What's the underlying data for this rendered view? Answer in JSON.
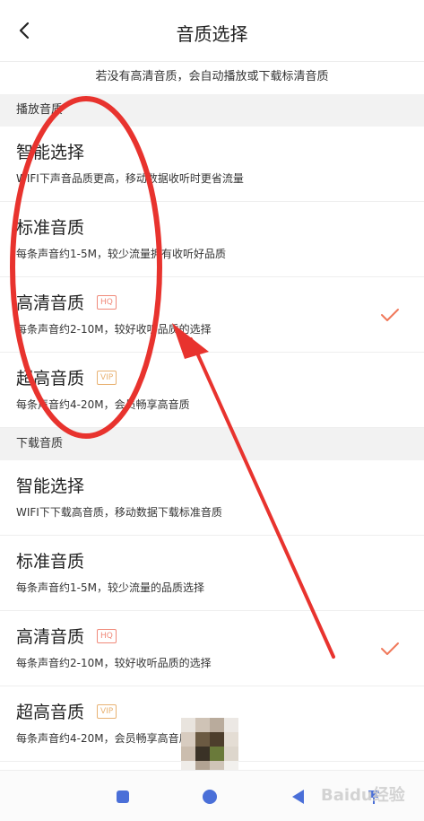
{
  "header": {
    "title": "音质选择",
    "back_icon": "chevron-left-icon"
  },
  "notice": "若没有高清音质，会自动播放或下载标清音质",
  "play_section": {
    "title": "播放音质",
    "items": [
      {
        "name": "智能选择",
        "desc": "WIFI下声音品质更高，移动数据收听时更省流量",
        "badge": "",
        "selected": false
      },
      {
        "name": "标准音质",
        "desc": "每条声音约1-5M，较少流量拥有收听好品质",
        "badge": "",
        "selected": false
      },
      {
        "name": "高清音质",
        "desc": "每条声音约2-10M，较好收听品质的选择",
        "badge": "HQ",
        "selected": true
      },
      {
        "name": "超高音质",
        "desc": "每条声音约4-20M，会员畅享高音质",
        "badge": "VIP",
        "selected": false
      }
    ]
  },
  "download_section": {
    "title": "下载音质",
    "items": [
      {
        "name": "智能选择",
        "desc": "WIFI下下载高音质，移动数据下载标准音质",
        "badge": "",
        "selected": false
      },
      {
        "name": "标准音质",
        "desc": "每条声音约1-5M，较少流量的品质选择",
        "badge": "",
        "selected": false
      },
      {
        "name": "高清音质",
        "desc": "每条声音约2-10M，较好收听品质的选择",
        "badge": "HQ",
        "selected": true
      },
      {
        "name": "超高音质",
        "desc": "每条声音约4-20M，会员畅享高音质",
        "badge": "VIP",
        "selected": false
      }
    ]
  },
  "navbar": {
    "icons": [
      "square-icon",
      "circle-icon",
      "triangle-back-icon",
      "pin-icon"
    ]
  },
  "watermark": "Baidu经验",
  "colors": {
    "accent": "#f0785a",
    "annotation": "#e8332e",
    "nav": "#4a6fd8",
    "hq_badge": "#f08a7a",
    "vip_badge": "#e8b273"
  }
}
